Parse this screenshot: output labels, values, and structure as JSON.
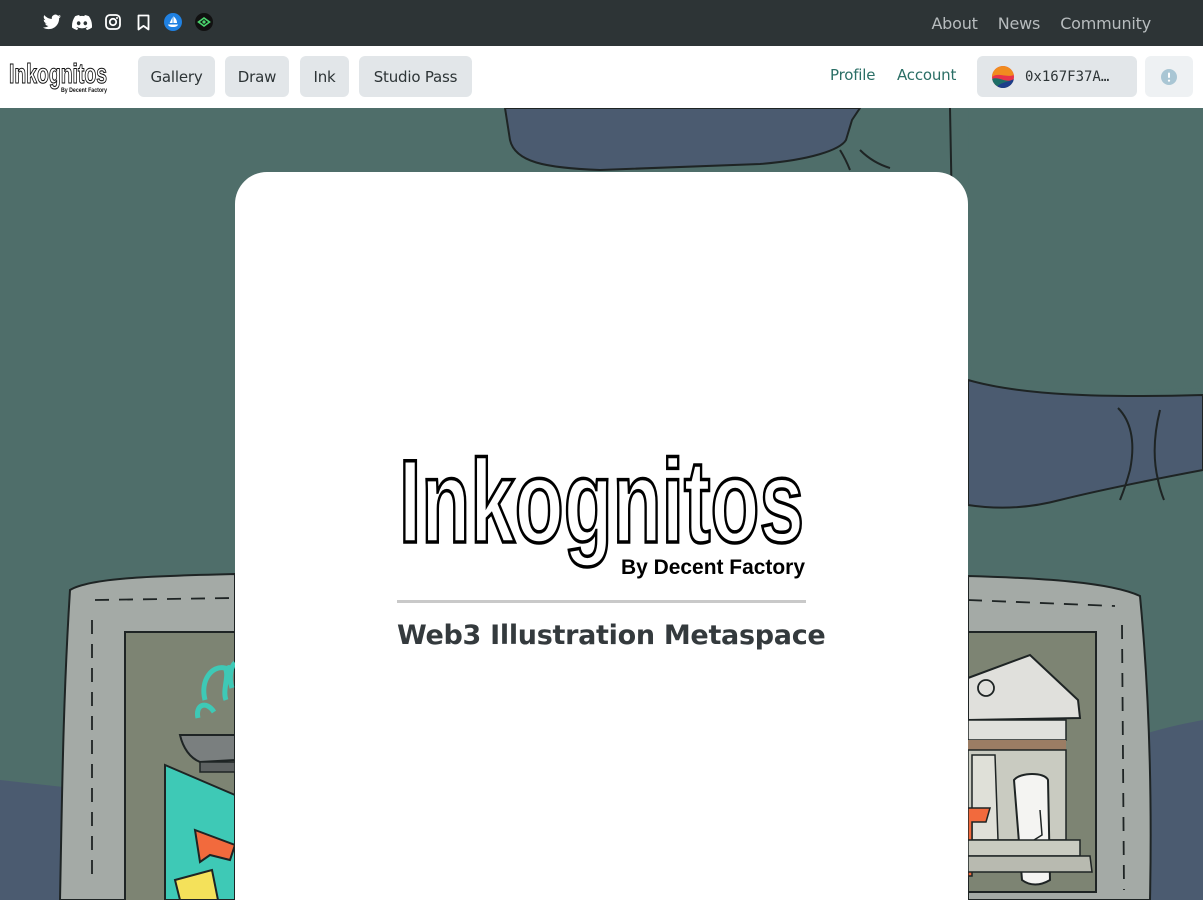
{
  "topbar": {
    "social_icons": [
      "twitter-icon",
      "discord-icon",
      "instagram-icon",
      "bookmark-icon",
      "opensea-icon",
      "signal-icon"
    ],
    "links": [
      "About",
      "News",
      "Community"
    ]
  },
  "navbar": {
    "brand_text": "Inkognitos",
    "brand_subtext": "By Decent Factory",
    "buttons": [
      "Gallery",
      "Draw",
      "Ink",
      "Studio Pass"
    ],
    "links": [
      "Profile",
      "Account"
    ],
    "wallet_address": "0x167F37A…",
    "alert_icon": "info-circle-icon"
  },
  "hero": {
    "logo_text": "Inkognitos",
    "logo_subtext": "By Decent Factory",
    "tagline": "Web3 Illustration Metaspace"
  },
  "colors": {
    "topbar_bg": "#2d3436",
    "nav_link": "#2b6f66",
    "scene_green": "#4f6e6a",
    "scene_blue": "#4b5b70",
    "fountain_teal": "#3ec9b6",
    "accent_orange": "#f26a3d"
  }
}
